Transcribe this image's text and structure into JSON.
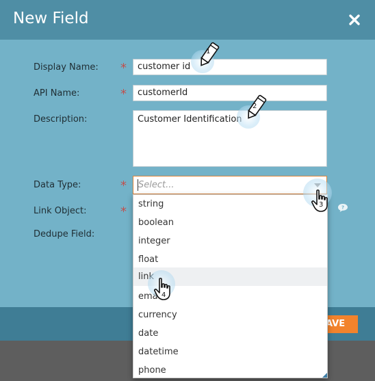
{
  "dialog": {
    "title": "New Field",
    "close_icon": "close-icon"
  },
  "form": {
    "display_name": {
      "label": "Display Name:",
      "required": "*",
      "value": "customer id"
    },
    "api_name": {
      "label": "API Name:",
      "required": "*",
      "value": "customerId"
    },
    "description": {
      "label": "Description:",
      "value": "Customer Identification"
    },
    "data_type": {
      "label": "Data Type:",
      "required": "*",
      "placeholder": "Select..."
    },
    "link_object": {
      "label": "Link Object:",
      "required": "*"
    },
    "dedupe_field": {
      "label": "Dedupe Field:"
    }
  },
  "dropdown": {
    "options": [
      "string",
      "boolean",
      "integer",
      "float",
      "link",
      "email",
      "currency",
      "date",
      "datetime",
      "phone"
    ],
    "visible_labels": [
      "string",
      "boolean",
      "integer",
      "float",
      "link",
      "ema",
      "currency",
      "date",
      "datetime",
      "phone"
    ],
    "highlighted": "link"
  },
  "footer": {
    "save_label": "AVE"
  },
  "annotations": {
    "step1": "1",
    "step2": "2",
    "step3": "3",
    "step4": "4"
  },
  "colors": {
    "header": "#4f8ea5",
    "body": "#73b2c8",
    "footer": "#3f7d95",
    "accent_orange": "#f2832c",
    "required_star": "#c0504d"
  }
}
